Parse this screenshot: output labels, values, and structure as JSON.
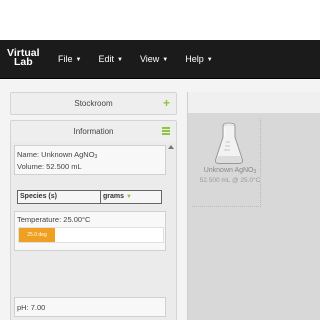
{
  "app": {
    "logo": {
      "line1": "Virtual",
      "line2": "Lab"
    }
  },
  "menu": [
    {
      "label": "File"
    },
    {
      "label": "Edit"
    },
    {
      "label": "View"
    },
    {
      "label": "Help"
    }
  ],
  "stockroom": {
    "title": "Stockroom",
    "icon": "plus-icon"
  },
  "information": {
    "title": "Information",
    "icon": "menu-icon",
    "name_prefix": "Name: Unknown AgNO",
    "name_sub": "3",
    "volume": "Volume: 52.500 mL",
    "species_header": "Species (s)",
    "grams_header": "grams",
    "temperature_label": "Temperature: 25.00°C",
    "temperature_bar_label": "25.0 deg",
    "temperature_fill": 0.25,
    "ph_label": "pH: 7.00"
  },
  "workbench": {
    "flask": {
      "name_prefix": "Unknown AgNO",
      "name_sub": "3",
      "detail": "52.500 mL @ 25.0°C",
      "icon": "erlenmeyer-flask-icon"
    }
  },
  "colors": {
    "navbar": "#1b1b1b",
    "accent_green": "#8cc63f",
    "temperature_bar": "#f0a020"
  }
}
